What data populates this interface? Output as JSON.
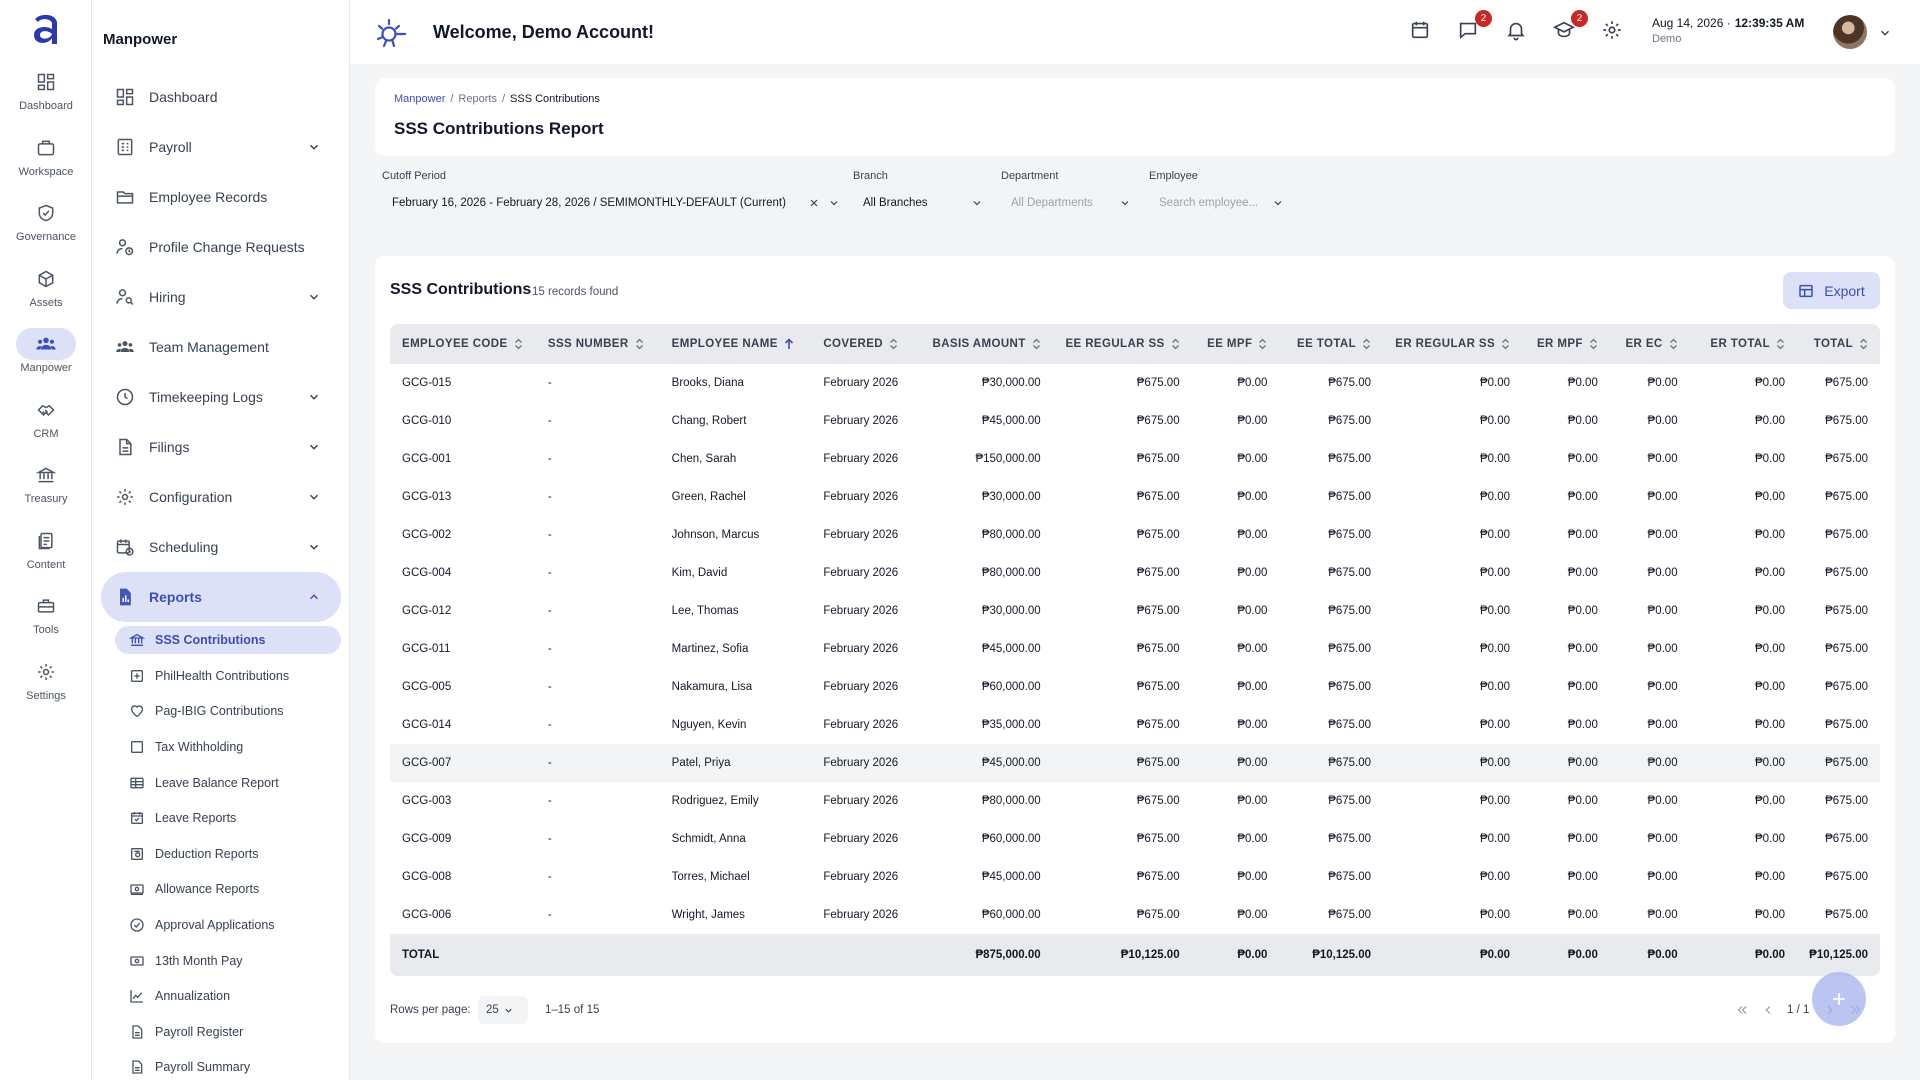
{
  "rail": {
    "items": [
      {
        "label": "Dashboard",
        "icon": "dashboard-icon"
      },
      {
        "label": "Workspace",
        "icon": "briefcase-icon"
      },
      {
        "label": "Governance",
        "icon": "shield-icon"
      },
      {
        "label": "Assets",
        "icon": "cube-icon"
      },
      {
        "label": "Manpower",
        "icon": "people-icon"
      },
      {
        "label": "CRM",
        "icon": "handshake-icon"
      },
      {
        "label": "Treasury",
        "icon": "bank-icon"
      },
      {
        "label": "Content",
        "icon": "documents-icon"
      },
      {
        "label": "Tools",
        "icon": "toolbox-icon"
      },
      {
        "label": "Settings",
        "icon": "gear-icon"
      }
    ]
  },
  "sidebar": {
    "title": "Manpower",
    "items": [
      {
        "label": "Dashboard"
      },
      {
        "label": "Payroll"
      },
      {
        "label": "Employee Records"
      },
      {
        "label": "Profile Change Requests"
      },
      {
        "label": "Hiring"
      },
      {
        "label": "Team Management"
      },
      {
        "label": "Timekeeping Logs"
      },
      {
        "label": "Filings"
      },
      {
        "label": "Configuration"
      },
      {
        "label": "Scheduling"
      },
      {
        "label": "Reports"
      }
    ],
    "reports": [
      {
        "label": "SSS Contributions"
      },
      {
        "label": "PhilHealth Contributions"
      },
      {
        "label": "Pag-IBIG Contributions"
      },
      {
        "label": "Tax Withholding"
      },
      {
        "label": "Leave Balance Report"
      },
      {
        "label": "Leave Reports"
      },
      {
        "label": "Deduction Reports"
      },
      {
        "label": "Allowance Reports"
      },
      {
        "label": "Approval Applications"
      },
      {
        "label": "13th Month Pay"
      },
      {
        "label": "Annualization"
      },
      {
        "label": "Payroll Register"
      },
      {
        "label": "Payroll Summary"
      }
    ]
  },
  "header": {
    "welcome": "Welcome, Demo Account!",
    "messages_badge": "2",
    "learning_badge": "2",
    "date": "Aug 14, 2026 ·",
    "time": "12:39:35 AM",
    "user": "Demo"
  },
  "page": {
    "breadcrumb": [
      "Manpower",
      "Reports",
      "SSS Contributions"
    ],
    "title": "SSS Contributions Report"
  },
  "filters": {
    "cutoff_label": "Cutoff Period",
    "cutoff_value": "February 16, 2026 - February 28, 2026 / SEMIMONTHLY-DEFAULT (Current)",
    "branch_label": "Branch",
    "branch_value": "All Branches",
    "department_label": "Department",
    "department_placeholder": "All Departments",
    "employee_label": "Employee",
    "employee_placeholder": "Search employee..."
  },
  "table": {
    "title": "SSS Contributions",
    "count": "15 records found",
    "export_label": "Export",
    "columns": [
      "EMPLOYEE CODE",
      "SSS NUMBER",
      "EMPLOYEE NAME",
      "COVERED",
      "BASIS AMOUNT",
      "EE REGULAR SS",
      "EE MPF",
      "EE TOTAL",
      "ER REGULAR SS",
      "ER MPF",
      "ER EC",
      "ER TOTAL",
      "TOTAL"
    ],
    "rows": [
      [
        "GCG-015",
        "-",
        "Brooks, Diana",
        "February 2026",
        "₱30,000.00",
        "₱675.00",
        "₱0.00",
        "₱675.00",
        "₱0.00",
        "₱0.00",
        "₱0.00",
        "₱0.00",
        "₱675.00"
      ],
      [
        "GCG-010",
        "-",
        "Chang, Robert",
        "February 2026",
        "₱45,000.00",
        "₱675.00",
        "₱0.00",
        "₱675.00",
        "₱0.00",
        "₱0.00",
        "₱0.00",
        "₱0.00",
        "₱675.00"
      ],
      [
        "GCG-001",
        "-",
        "Chen, Sarah",
        "February 2026",
        "₱150,000.00",
        "₱675.00",
        "₱0.00",
        "₱675.00",
        "₱0.00",
        "₱0.00",
        "₱0.00",
        "₱0.00",
        "₱675.00"
      ],
      [
        "GCG-013",
        "-",
        "Green, Rachel",
        "February 2026",
        "₱30,000.00",
        "₱675.00",
        "₱0.00",
        "₱675.00",
        "₱0.00",
        "₱0.00",
        "₱0.00",
        "₱0.00",
        "₱675.00"
      ],
      [
        "GCG-002",
        "-",
        "Johnson, Marcus",
        "February 2026",
        "₱80,000.00",
        "₱675.00",
        "₱0.00",
        "₱675.00",
        "₱0.00",
        "₱0.00",
        "₱0.00",
        "₱0.00",
        "₱675.00"
      ],
      [
        "GCG-004",
        "-",
        "Kim, David",
        "February 2026",
        "₱80,000.00",
        "₱675.00",
        "₱0.00",
        "₱675.00",
        "₱0.00",
        "₱0.00",
        "₱0.00",
        "₱0.00",
        "₱675.00"
      ],
      [
        "GCG-012",
        "-",
        "Lee, Thomas",
        "February 2026",
        "₱30,000.00",
        "₱675.00",
        "₱0.00",
        "₱675.00",
        "₱0.00",
        "₱0.00",
        "₱0.00",
        "₱0.00",
        "₱675.00"
      ],
      [
        "GCG-011",
        "-",
        "Martinez, Sofia",
        "February 2026",
        "₱45,000.00",
        "₱675.00",
        "₱0.00",
        "₱675.00",
        "₱0.00",
        "₱0.00",
        "₱0.00",
        "₱0.00",
        "₱675.00"
      ],
      [
        "GCG-005",
        "-",
        "Nakamura, Lisa",
        "February 2026",
        "₱60,000.00",
        "₱675.00",
        "₱0.00",
        "₱675.00",
        "₱0.00",
        "₱0.00",
        "₱0.00",
        "₱0.00",
        "₱675.00"
      ],
      [
        "GCG-014",
        "-",
        "Nguyen, Kevin",
        "February 2026",
        "₱35,000.00",
        "₱675.00",
        "₱0.00",
        "₱675.00",
        "₱0.00",
        "₱0.00",
        "₱0.00",
        "₱0.00",
        "₱675.00"
      ],
      [
        "GCG-007",
        "-",
        "Patel, Priya",
        "February 2026",
        "₱45,000.00",
        "₱675.00",
        "₱0.00",
        "₱675.00",
        "₱0.00",
        "₱0.00",
        "₱0.00",
        "₱0.00",
        "₱675.00"
      ],
      [
        "GCG-003",
        "-",
        "Rodriguez, Emily",
        "February 2026",
        "₱80,000.00",
        "₱675.00",
        "₱0.00",
        "₱675.00",
        "₱0.00",
        "₱0.00",
        "₱0.00",
        "₱0.00",
        "₱675.00"
      ],
      [
        "GCG-009",
        "-",
        "Schmidt, Anna",
        "February 2026",
        "₱60,000.00",
        "₱675.00",
        "₱0.00",
        "₱675.00",
        "₱0.00",
        "₱0.00",
        "₱0.00",
        "₱0.00",
        "₱675.00"
      ],
      [
        "GCG-008",
        "-",
        "Torres, Michael",
        "February 2026",
        "₱45,000.00",
        "₱675.00",
        "₱0.00",
        "₱675.00",
        "₱0.00",
        "₱0.00",
        "₱0.00",
        "₱0.00",
        "₱675.00"
      ],
      [
        "GCG-006",
        "-",
        "Wright, James",
        "February 2026",
        "₱60,000.00",
        "₱675.00",
        "₱0.00",
        "₱675.00",
        "₱0.00",
        "₱0.00",
        "₱0.00",
        "₱0.00",
        "₱675.00"
      ]
    ],
    "totals": [
      "TOTAL",
      "",
      "",
      "",
      "₱875,000.00",
      "₱10,125.00",
      "₱0.00",
      "₱10,125.00",
      "₱0.00",
      "₱0.00",
      "₱0.00",
      "₱0.00",
      "₱10,125.00"
    ]
  },
  "pagination": {
    "rows_label": "Rows per page:",
    "rows_value": "25",
    "range": "1–15 of 15",
    "page": "1 / 1"
  },
  "colors": {
    "accent": "#3d4fb0",
    "accent_bg": "#dde1f7",
    "badge": "#c62828"
  }
}
